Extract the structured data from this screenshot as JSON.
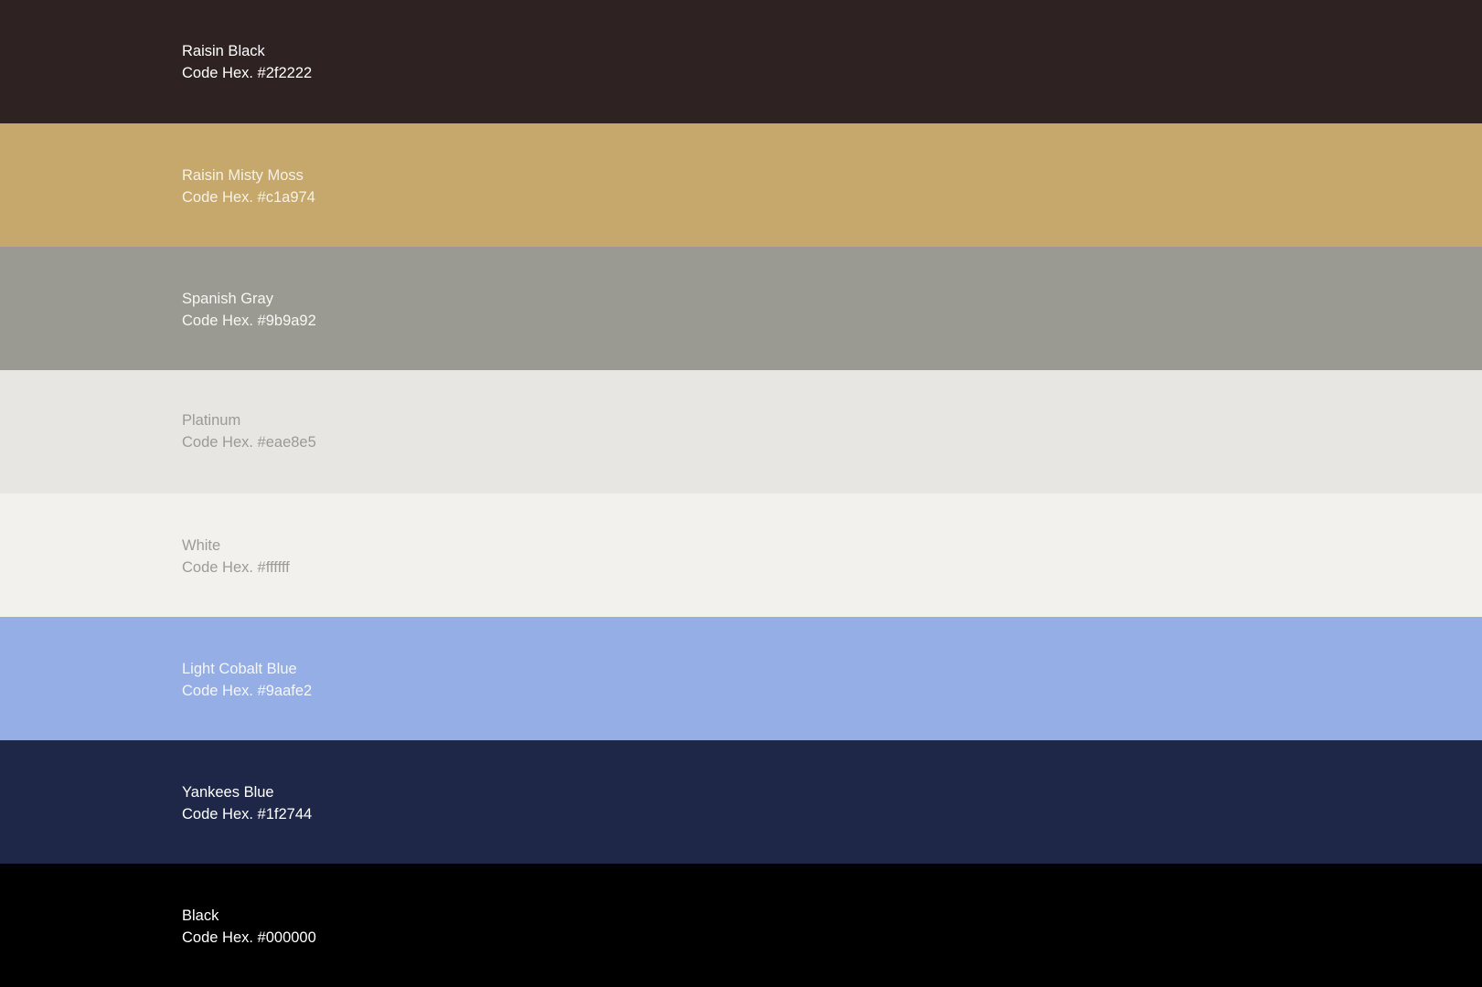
{
  "swatches": [
    {
      "name": "Raisin Black",
      "code": "Code Hex. #2f2222",
      "color": "#2f2222",
      "text_color": "#ffffff"
    },
    {
      "name": "Raisin Misty Moss",
      "code": "Code Hex. #c1a974",
      "color": "#c6a86d",
      "text_color": "#f7f1e4"
    },
    {
      "name": "Spanish Gray",
      "code": "Code Hex. #9b9a92",
      "color": "#9b9a92",
      "text_color": "#f6f6f3"
    },
    {
      "name": "Platinum",
      "code": "Code Hex. #eae8e5",
      "color": "#e7e6e2",
      "text_color": "#9a9a97"
    },
    {
      "name": "White",
      "code": "Code Hex. #ffffff",
      "color": "#f2f1ed",
      "text_color": "#9c9b98"
    },
    {
      "name": "Light Cobalt Blue",
      "code": "Code Hex. #9aafe2",
      "color": "#95aee5",
      "text_color": "#f3f6fc"
    },
    {
      "name": "Yankees Blue",
      "code": "Code Hex. #1f2744",
      "color": "#1e2747",
      "text_color": "#ffffff"
    },
    {
      "name": "Black",
      "code": "Code Hex. #000000",
      "color": "#000000",
      "text_color": "#ffffff"
    }
  ]
}
